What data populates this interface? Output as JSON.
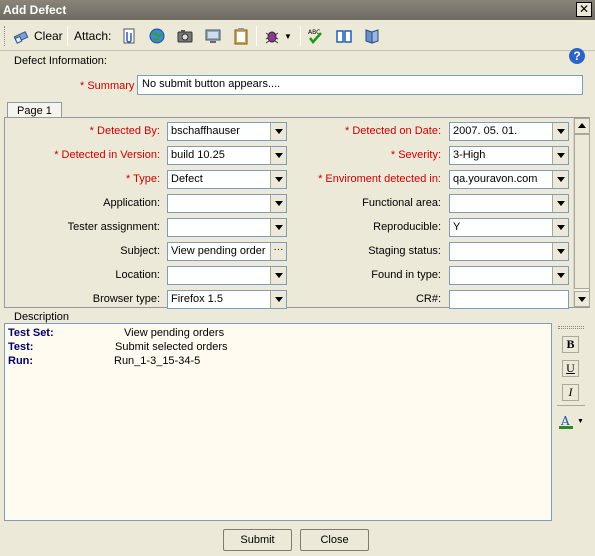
{
  "window": {
    "title": "Add Defect"
  },
  "toolbar": {
    "clear_label": "Clear",
    "attach_label": "Attach:",
    "help_label": "?"
  },
  "section": {
    "defect_info": "Defect Information:",
    "description": "Description"
  },
  "summary": {
    "label": "Summary",
    "value": "No submit button appears...."
  },
  "tabs": [
    {
      "label": "Page 1"
    }
  ],
  "fields_left": [
    {
      "label": "Detected By:",
      "required": true,
      "value": "bschaffhauser",
      "kind": "combo"
    },
    {
      "label": "Detected in Version:",
      "required": true,
      "value": "build 10.25",
      "kind": "combo"
    },
    {
      "label": "Type:",
      "required": true,
      "value": "Defect",
      "kind": "combo"
    },
    {
      "label": "Application:",
      "required": false,
      "value": "",
      "kind": "combo"
    },
    {
      "label": "Tester assignment:",
      "required": false,
      "value": "",
      "kind": "combo"
    },
    {
      "label": "Subject:",
      "required": false,
      "value": "View pending order",
      "kind": "browse"
    },
    {
      "label": "Location:",
      "required": false,
      "value": "",
      "kind": "combo"
    },
    {
      "label": "Browser type:",
      "required": false,
      "value": "Firefox 1.5",
      "kind": "combo"
    }
  ],
  "fields_right": [
    {
      "label": "Detected on Date:",
      "required": true,
      "value": "2007. 05. 01.",
      "kind": "combo"
    },
    {
      "label": "Severity:",
      "required": true,
      "value": "3-High",
      "kind": "combo"
    },
    {
      "label": "Enviroment detected in:",
      "required": true,
      "value": "qa.youravon.com",
      "kind": "combo"
    },
    {
      "label": "Functional area:",
      "required": false,
      "value": "",
      "kind": "combo"
    },
    {
      "label": "Reproducible:",
      "required": false,
      "value": "Y",
      "kind": "combo"
    },
    {
      "label": "Staging status:",
      "required": false,
      "value": "",
      "kind": "combo"
    },
    {
      "label": "Found in type:",
      "required": false,
      "value": "",
      "kind": "combo"
    },
    {
      "label": "CR#:",
      "required": false,
      "value": "",
      "kind": "text"
    }
  ],
  "description": [
    {
      "key": "Test Set:",
      "value": "View pending orders"
    },
    {
      "key": "Test:",
      "value": "Submit selected orders"
    },
    {
      "key": "Run:",
      "value": "Run_1-3_15-34-5"
    }
  ],
  "format": {
    "bold": "B",
    "underline": "U",
    "italic": "I"
  },
  "buttons": {
    "submit": "Submit",
    "close": "Close"
  }
}
